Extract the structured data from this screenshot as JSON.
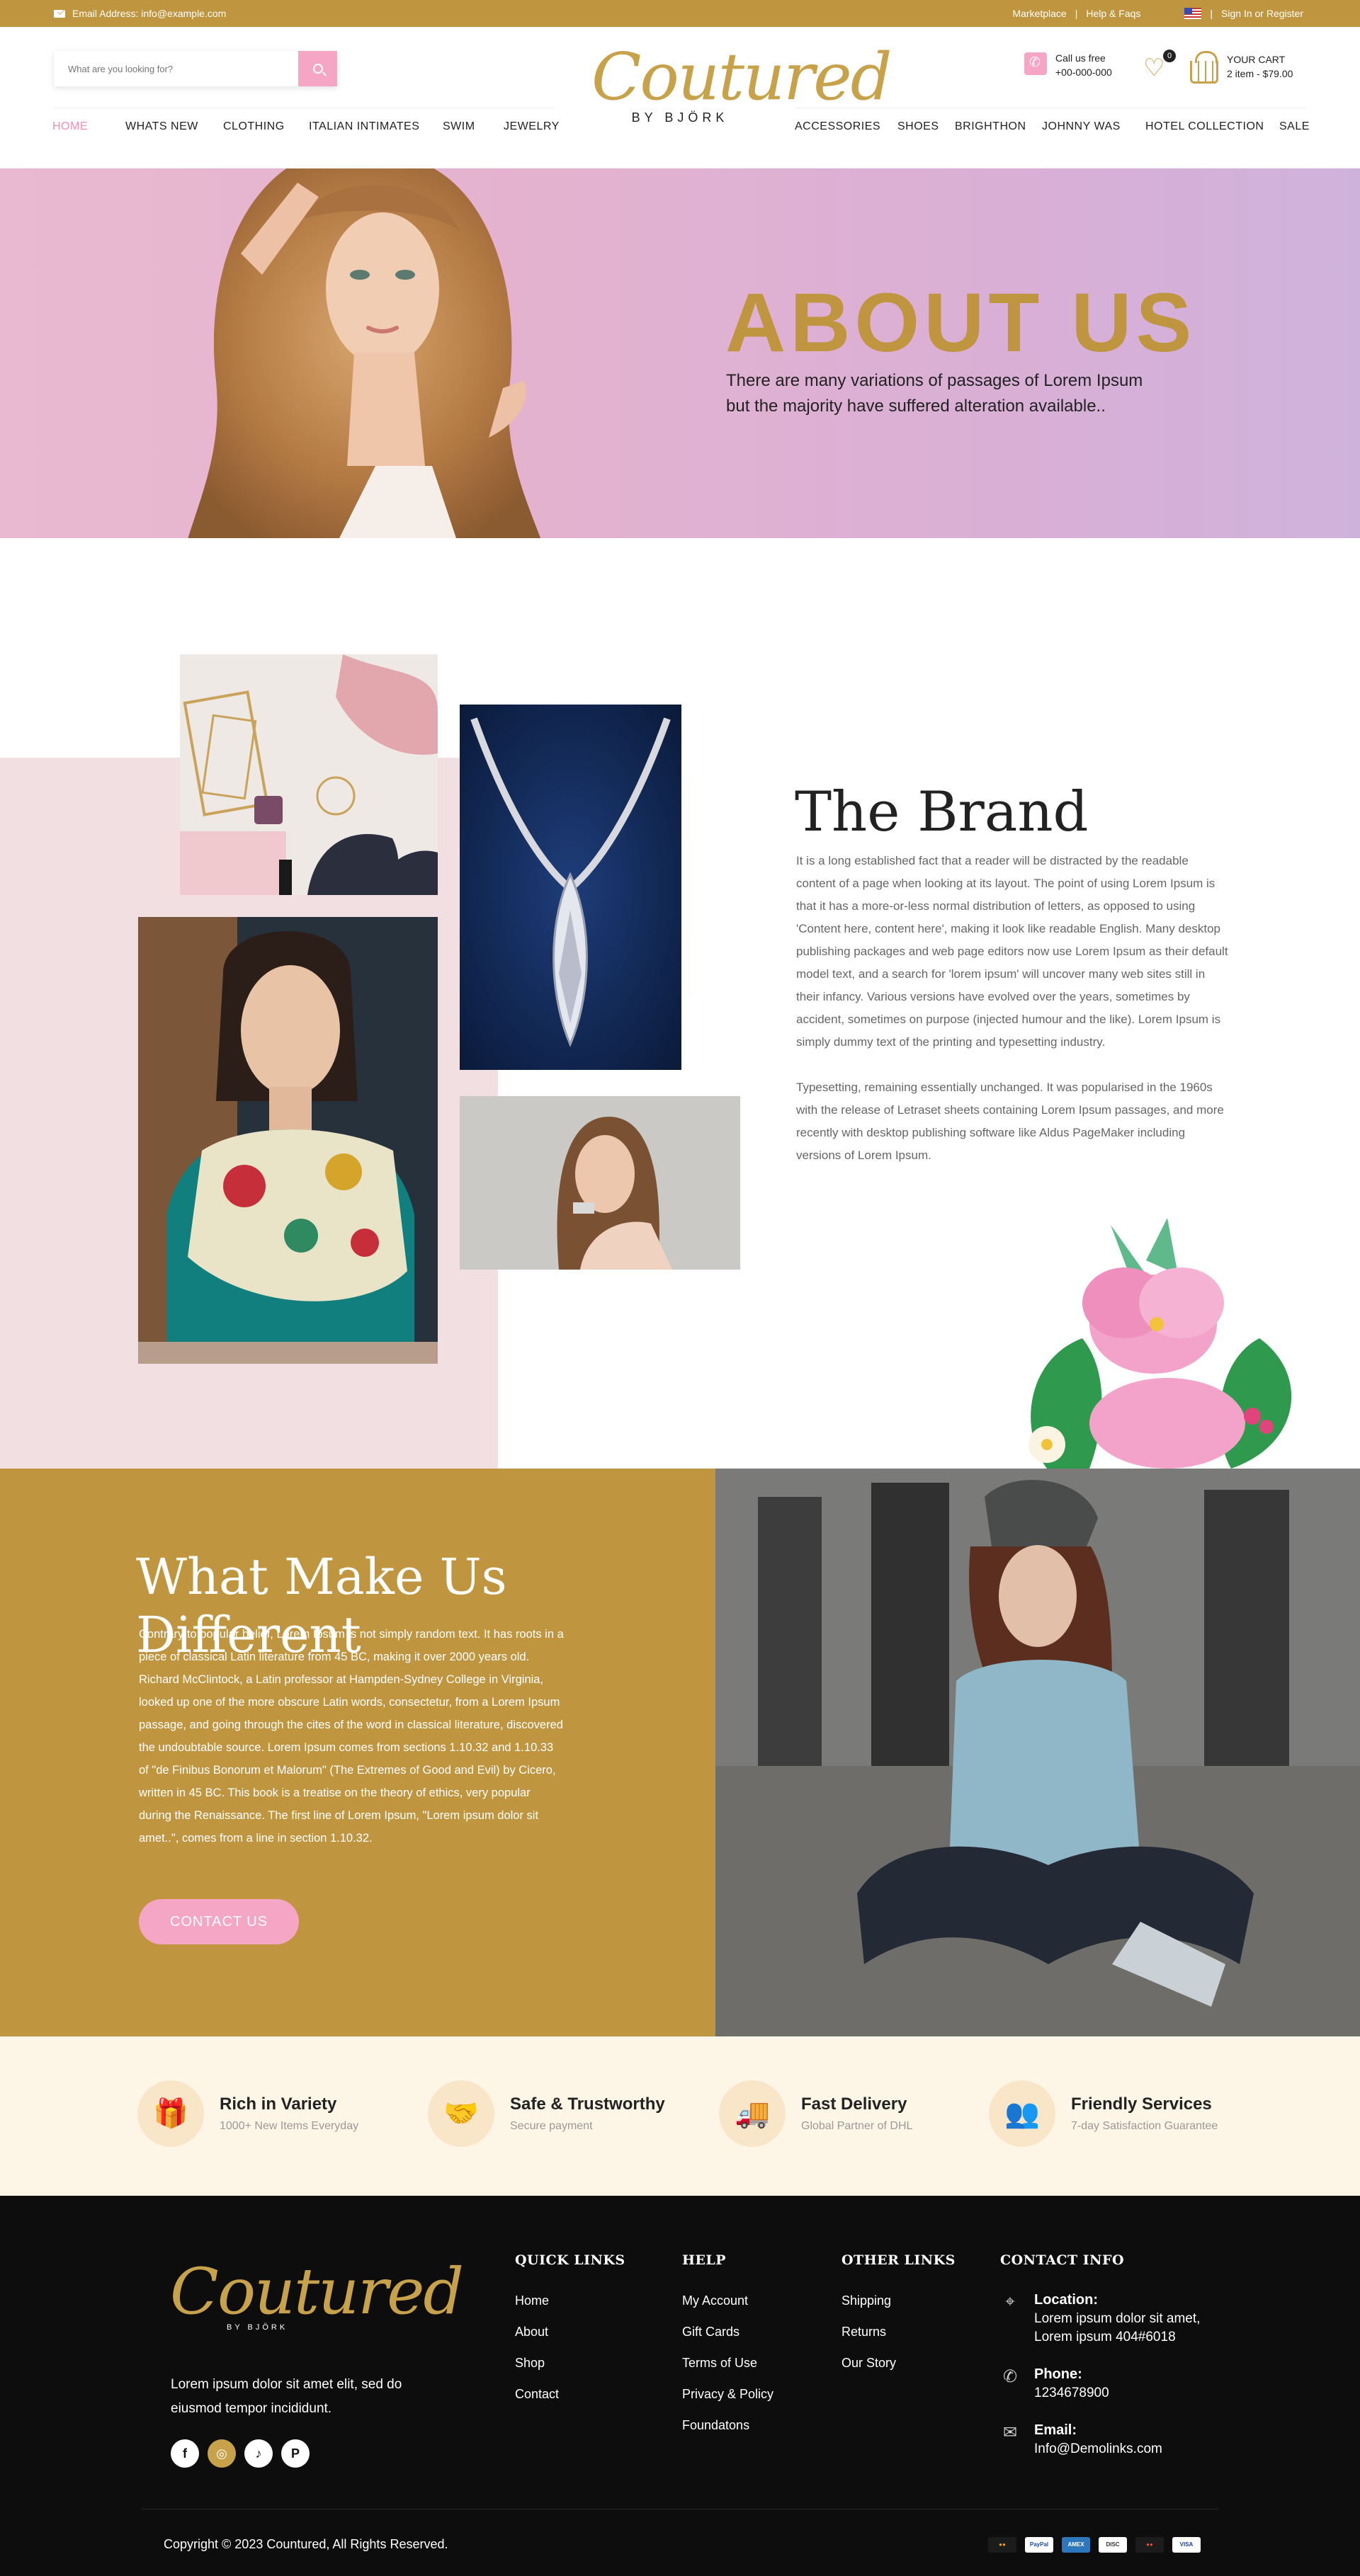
{
  "topbar": {
    "email_label": "Email Address: info@example.com",
    "marketplace": "Marketplace",
    "sep1": "|",
    "help": "Help & Faqs",
    "sep2": "|",
    "signin": "Sign In or Register"
  },
  "header": {
    "search_placeholder": "What are you looking for?",
    "logo_script": "Coutured",
    "logo_by": "BY BJÖRK",
    "call_label": "Call us free",
    "call_number": "+00-000-000",
    "wishlist_count": "0",
    "cart_label": "YOUR CART",
    "cart_summary": "2 item - $79.00"
  },
  "nav_left": [
    "HOME",
    "WHATS NEW",
    "CLOTHING",
    "ITALIAN INTIMATES",
    "SWIM",
    "JEWELRY"
  ],
  "nav_right": [
    "ACCESSORIES",
    "SHOES",
    "BRIGHTHON",
    "JOHNNY WAS",
    "HOTEL COLLECTION",
    "SALE"
  ],
  "hero": {
    "title": "ABOUT US",
    "line1": "There are many variations of passages of Lorem Ipsum",
    "line2": "but the majority have suffered alteration available.."
  },
  "brand": {
    "title": "The Brand",
    "para1": "It is a long established fact that a reader will be distracted by the readable content of a page when looking at its layout. The point of using Lorem Ipsum is that it has a more-or-less normal distribution of letters, as opposed to using 'Content here, content here', making it look like readable English. Many desktop publishing packages and web page editors now use Lorem Ipsum as their default model text, and a search for 'lorem ipsum' will uncover many web sites still in their infancy. Various versions have evolved over the years, sometimes by accident, sometimes on purpose (injected humour and the like). Lorem Ipsum is simply dummy text of the printing and typesetting industry.",
    "para2": "Typesetting, remaining essentially unchanged. It was popularised in the 1960s with the release of Letraset sheets containing Lorem Ipsum passages, and more recently with desktop publishing software like Aldus PageMaker including versions of Lorem Ipsum."
  },
  "different": {
    "title": "What Make Us Different",
    "body": "Contrary to popular belief, Lorem Ipsum is not simply random text. It has roots in a piece of classical Latin literature from 45 BC, making it over 2000 years old. Richard McClintock, a Latin professor at Hampden-Sydney College in Virginia, looked up one of the more obscure Latin words, consectetur, from a Lorem Ipsum passage, and going through the cites of the word in classical literature, discovered the undoubtable source. Lorem Ipsum comes from sections 1.10.32 and 1.10.33 of \"de Finibus Bonorum et Malorum\" (The Extremes of Good and Evil) by Cicero, written in 45 BC. This book is a treatise on the theory of ethics, very popular during the Renaissance. The first line of Lorem Ipsum, \"Lorem ipsum dolor sit amet..\", comes from a line in section 1.10.32.",
    "button": "CONTACT US"
  },
  "features": [
    {
      "icon": "gift-box-icon",
      "glyph": "🎁",
      "title": "Rich in Variety",
      "sub": "1000+ New Items Everyday"
    },
    {
      "icon": "handshake-icon",
      "glyph": "🤝",
      "title": "Safe & Trustworthy",
      "sub": "Secure payment"
    },
    {
      "icon": "truck-icon",
      "glyph": "🚚",
      "title": "Fast Delivery",
      "sub": "Global Partner of DHL"
    },
    {
      "icon": "support-team-icon",
      "glyph": "👥",
      "title": "Friendly Services",
      "sub": "7-day Satisfaction Guarantee"
    }
  ],
  "footer": {
    "logo_script": "Coutured",
    "logo_by": "BY BJÖRK",
    "desc": "Lorem ipsum dolor sit amet elit, sed do eiusmod tempor incididunt.",
    "quick_title": "QUICK LINKS",
    "quick": [
      "Home",
      "About",
      "Shop",
      "Contact"
    ],
    "help_title": "HELP",
    "help": [
      "My Account",
      "Gift Cards",
      "Terms of Use",
      "Privacy & Policy",
      "Foundatons"
    ],
    "other_title": "OTHER LINKS",
    "other": [
      "Shipping",
      "Returns",
      "Our Story"
    ],
    "contact_title": "CONTACT INFO",
    "location_label": "Location:",
    "location_1": "Lorem ipsum dolor sit amet,",
    "location_2": "Lorem ipsum 404#6018",
    "phone_label": "Phone:",
    "phone": "1234678900",
    "email_label": "Email:",
    "email": "Info@Demolinks.com",
    "copyright": "Copyright © 2023 Countured, All Rights Reserved.",
    "payments": [
      "MasterCard",
      "PayPal",
      "Amex",
      "Discover",
      "Maestro",
      "VISA"
    ]
  },
  "colors": {
    "gold": "#bf953f",
    "pink": "#f4a6c4",
    "cream": "#fdf6e7",
    "footer": "#0d0d0d"
  }
}
